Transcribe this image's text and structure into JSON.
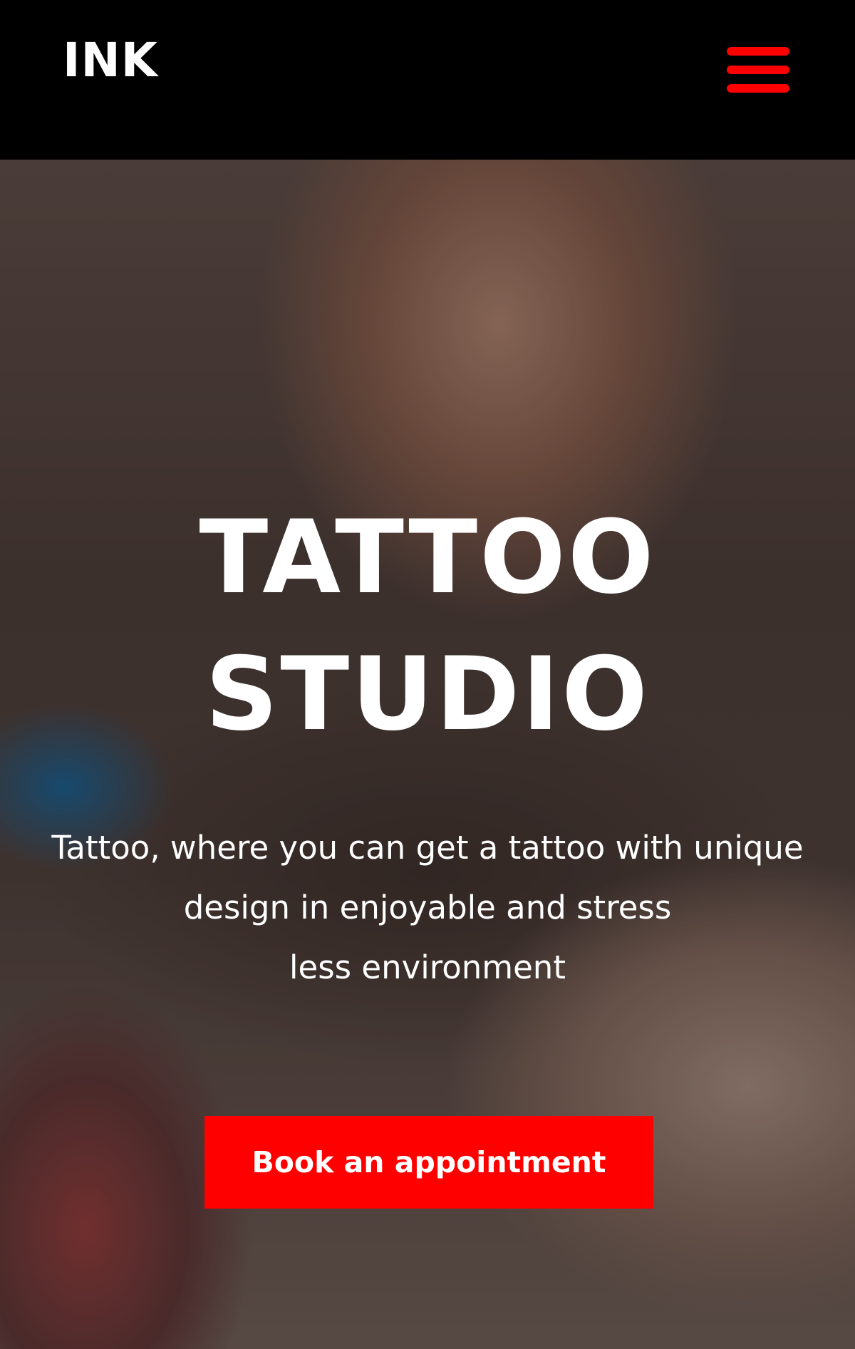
{
  "header": {
    "logo": "INK",
    "menu_icon": "hamburger-menu-icon"
  },
  "hero": {
    "title_line_1": "TATTOO",
    "title_line_2": "STUDIO",
    "description_line_1": "Tattoo, where you can get a tattoo with unique",
    "description_line_2": "design in enjoyable and stress",
    "description_line_3": "less environment",
    "cta_label": "Book an appointment"
  },
  "colors": {
    "accent": "#ff0000",
    "header_background": "#000000",
    "text": "#ffffff"
  }
}
